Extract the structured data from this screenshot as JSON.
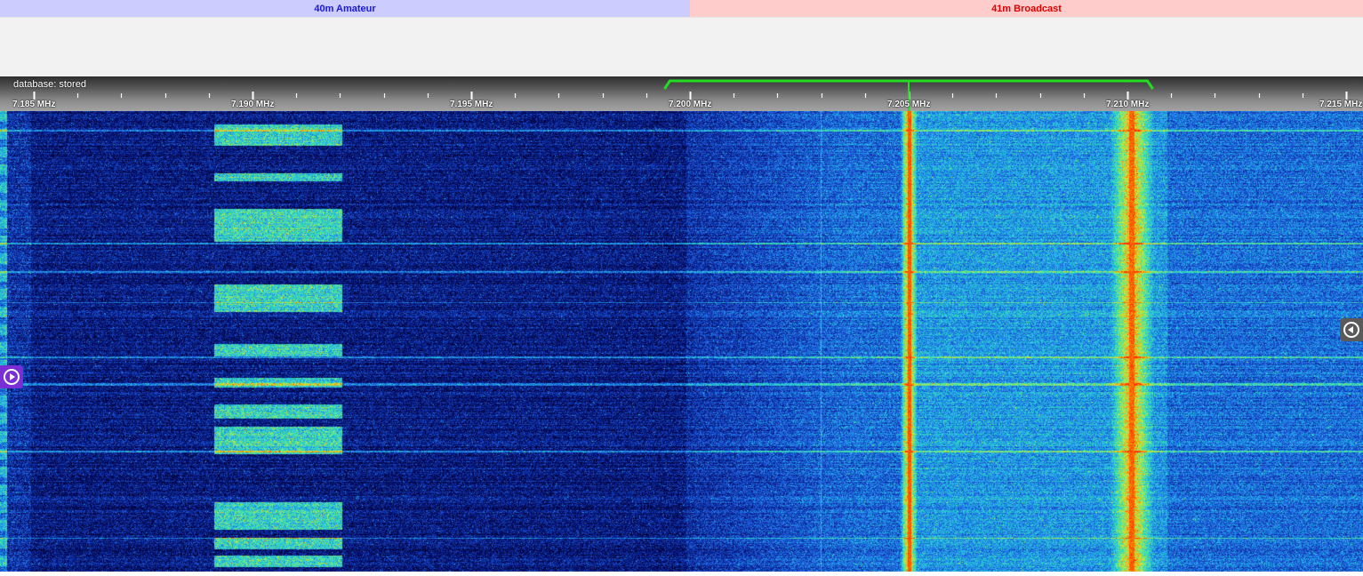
{
  "band_plan": {
    "amateur_label": "40m Amateur",
    "broadcast_label": "41m Broadcast",
    "amateur_color": "#ccccff",
    "broadcast_color": "#ffcccc"
  },
  "scale": {
    "database_status": "database: stored",
    "unit": "MHz",
    "labels": [
      "7.185 MHz",
      "7.190 MHz",
      "7.195 MHz",
      "7.200 MHz",
      "7.205 MHz",
      "7.210 MHz",
      "7.215 MHz"
    ],
    "start_mhz": 7.185,
    "end_mhz": 7.215,
    "passband": {
      "low_mhz": 7.1995,
      "high_mhz": 7.2105,
      "center_mhz": 7.205,
      "color": "#22dd22"
    }
  },
  "waterfall": {
    "colormap": [
      "#000033",
      "#0a1f8f",
      "#1e5fe0",
      "#22b8e8",
      "#44e8a0",
      "#d6e830",
      "#ff8000",
      "#ff1a00"
    ],
    "carriers_mhz": [
      7.205,
      7.2101
    ]
  },
  "controls": {
    "left_button_icon": "play-circle-icon",
    "right_button_icon": "back-circle-icon",
    "left_button_color": "#7a2fd6",
    "right_button_color": "#5a5a5a"
  }
}
